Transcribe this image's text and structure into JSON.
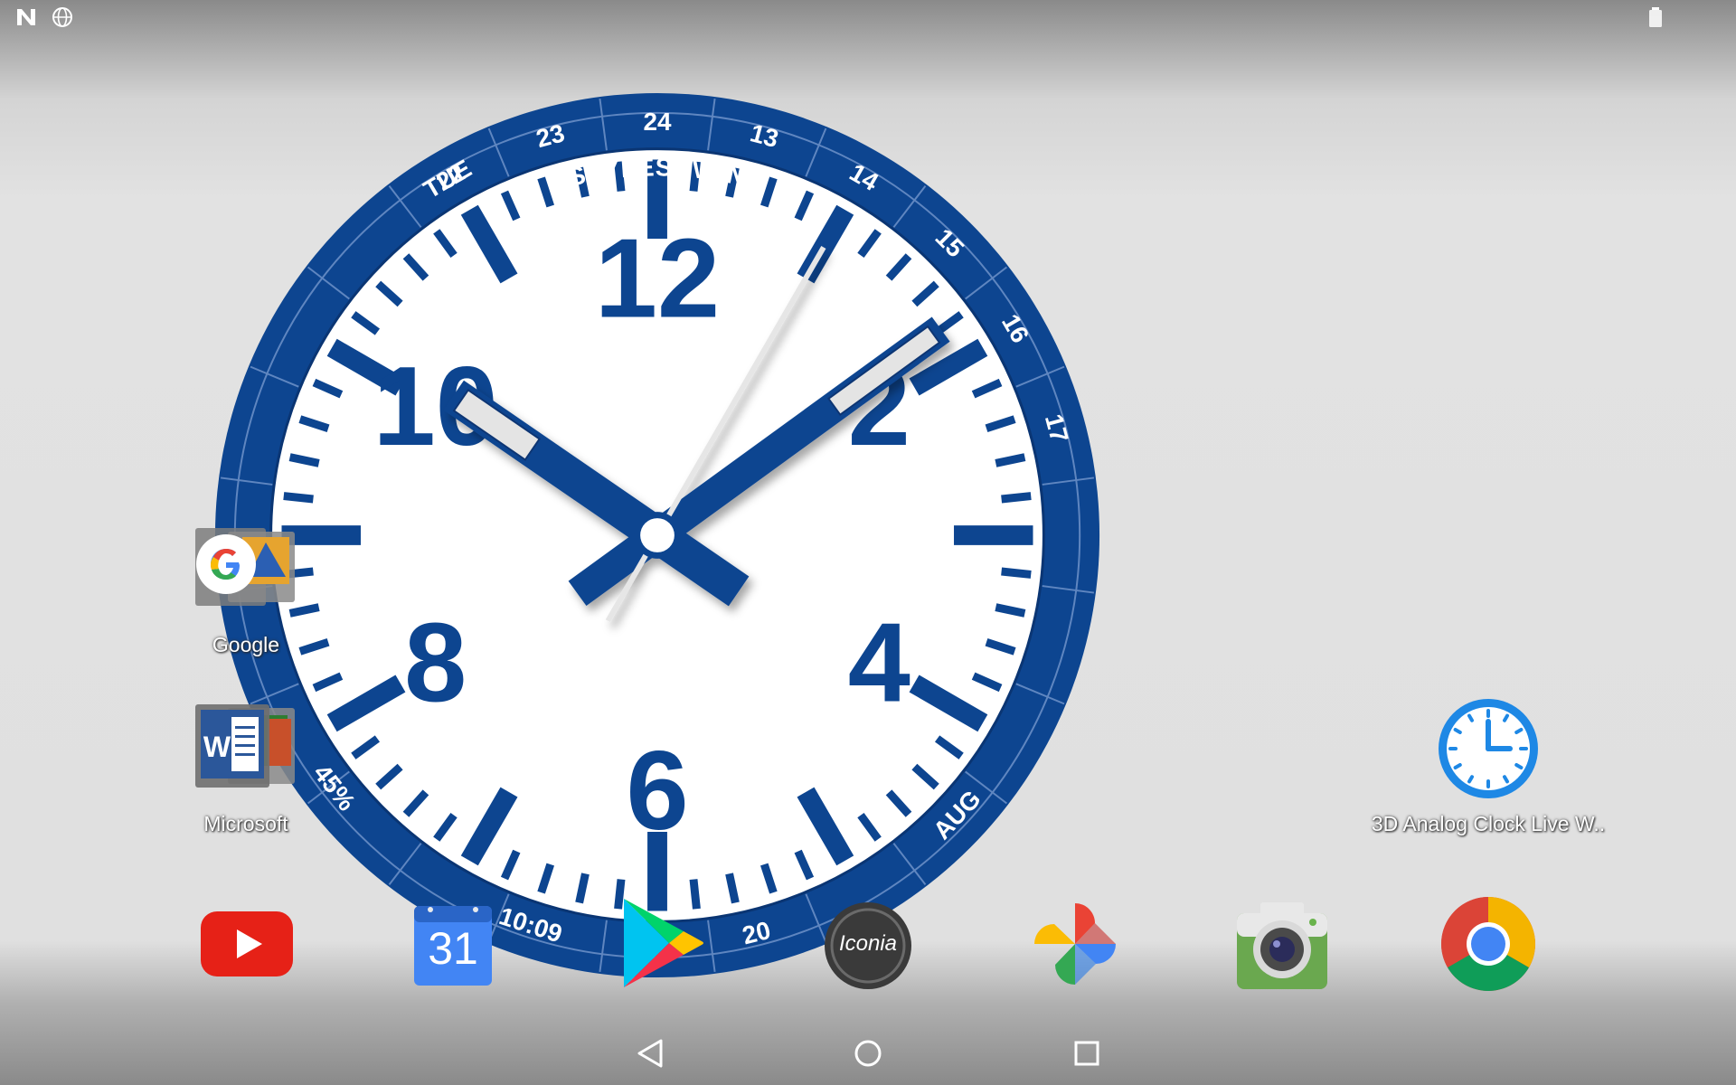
{
  "status_bar": {
    "left_icons": [
      "n-logo-icon",
      "globe-icon"
    ],
    "right_icons": [
      "battery-icon"
    ]
  },
  "clock_widget": {
    "brand": "STYLESEVEN",
    "weekday": "TUE",
    "month": "AUG",
    "digital_time": "10:09",
    "battery_percent": "45%",
    "day_of_month": "20",
    "hour_numerals": [
      "12",
      "2",
      "4",
      "6",
      "8",
      "10"
    ],
    "bezel_hours": [
      "24",
      "13",
      "14",
      "15",
      "16",
      "17",
      "23",
      "22"
    ],
    "hands": {
      "hour": 10,
      "minute": 9,
      "second": 35
    },
    "colors": {
      "navy": "#0d4590",
      "white": "#ffffff"
    }
  },
  "desktop": {
    "folders": [
      {
        "label": "Google",
        "icon": "google-folder-icon"
      },
      {
        "label": "Microsoft",
        "icon": "microsoft-folder-icon"
      }
    ],
    "shortcut": {
      "label": "3D Analog Clock Live W..",
      "icon": "clock-icon"
    }
  },
  "dock": {
    "apps": [
      {
        "name": "YouTube",
        "icon": "youtube-icon"
      },
      {
        "name": "Calendar",
        "icon": "calendar-icon",
        "badge": "31"
      },
      {
        "name": "Play Store",
        "icon": "play-store-icon"
      },
      {
        "name": "Iconia",
        "icon": "iconia-icon",
        "label": "Iconia"
      },
      {
        "name": "Photos",
        "icon": "photos-icon"
      },
      {
        "name": "Camera",
        "icon": "camera-icon"
      },
      {
        "name": "Chrome",
        "icon": "chrome-icon"
      }
    ]
  },
  "nav_bar": {
    "buttons": [
      "back-icon",
      "home-icon",
      "recents-icon"
    ]
  }
}
